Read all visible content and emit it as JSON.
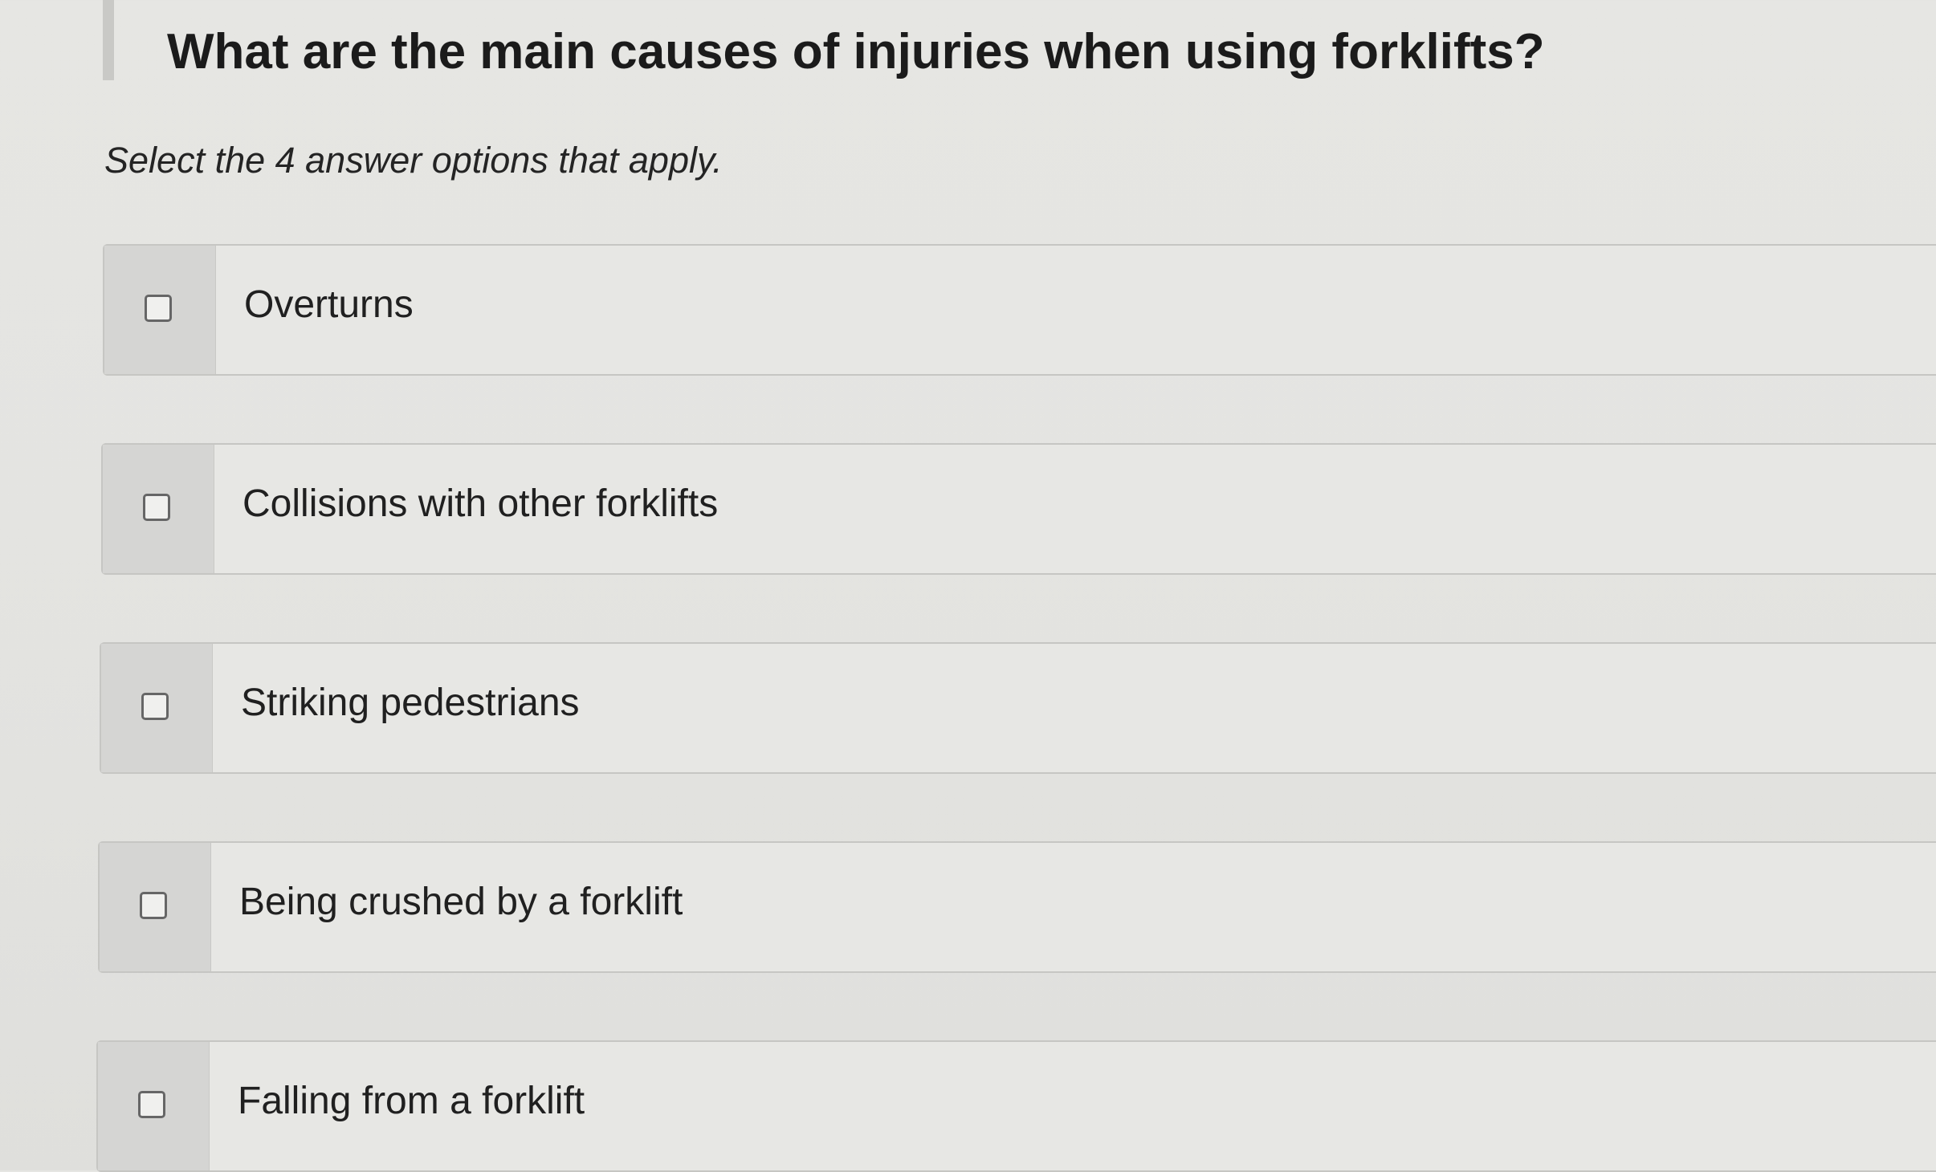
{
  "question": {
    "title": "What are the main causes of injuries when using forklifts?",
    "instruction": "Select the 4 answer options that apply."
  },
  "options": [
    {
      "label": "Overturns",
      "checked": false
    },
    {
      "label": "Collisions with other forklifts",
      "checked": false
    },
    {
      "label": "Striking pedestrians",
      "checked": false
    },
    {
      "label": "Being crushed by a forklift",
      "checked": false
    },
    {
      "label": "Falling from a forklift",
      "checked": false
    }
  ],
  "colors": {
    "background": "#e4e4e1",
    "checkbox_cell": "#d5d5d3",
    "text": "#1f1f1f"
  }
}
